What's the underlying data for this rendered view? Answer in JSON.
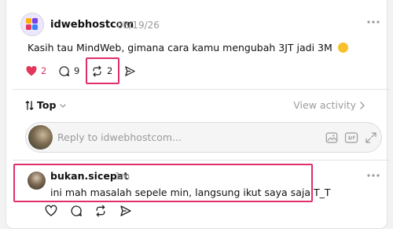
{
  "post": {
    "author": "idwebhostcom",
    "time": "08/19/26",
    "text": "Kasih tau MindWeb, gimana cara kamu mengubah 3JT jadi 3M",
    "emoji": "rolling-on-floor-laughing-emoji",
    "likes": "2",
    "replies": "9",
    "reposts": "2"
  },
  "sort": {
    "label": "Top",
    "view_activity": "View activity"
  },
  "composer": {
    "placeholder": "Reply to idwebhostcom..."
  },
  "comment": {
    "author": "bukan.sicepat",
    "time": "1m",
    "text": "ini mah masalah sepele min, langsung ikut saya saja T_T"
  },
  "colors": {
    "accent_like": "#e2365b",
    "highlight": "#e0306a",
    "muted": "#9a9a9a"
  }
}
